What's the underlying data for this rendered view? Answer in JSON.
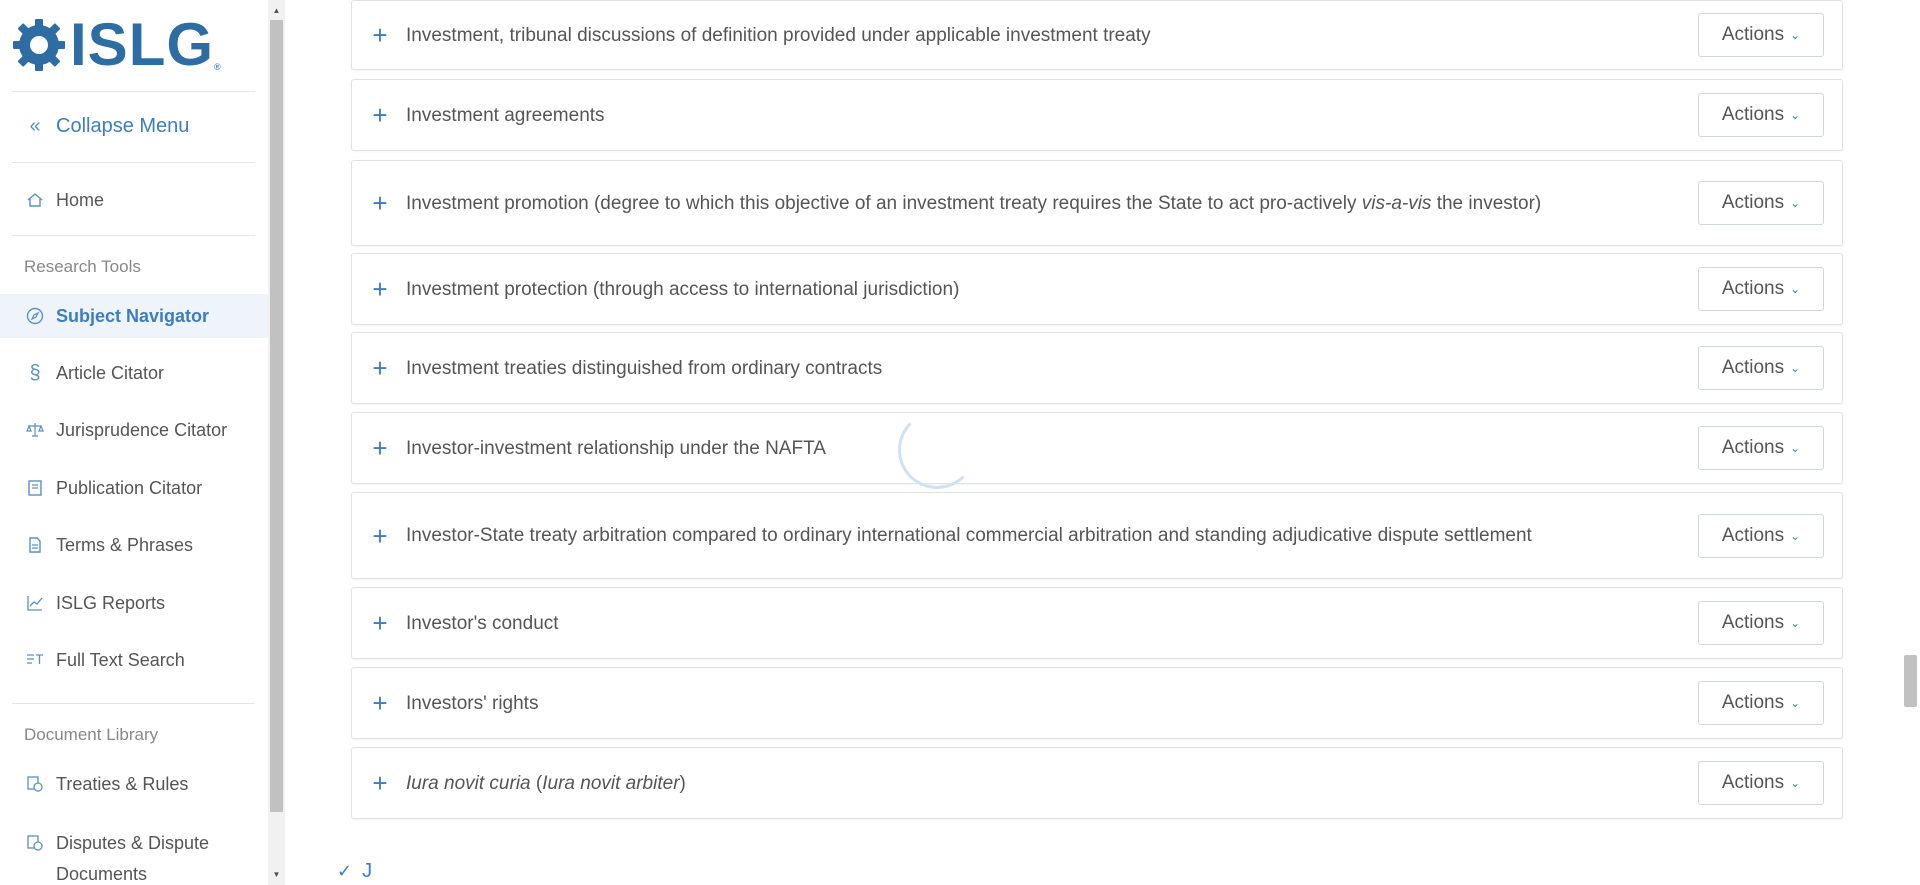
{
  "brand": {
    "name": "ISLG",
    "reg": "®"
  },
  "sidebar": {
    "collapse_label": "Collapse Menu",
    "home_label": "Home",
    "research_tools_label": "Research Tools",
    "research_items": [
      {
        "label": "Subject Navigator",
        "icon": "compass-icon"
      },
      {
        "label": "Article Citator",
        "icon": "section-icon"
      },
      {
        "label": "Jurisprudence Citator",
        "icon": "scales-icon"
      },
      {
        "label": "Publication Citator",
        "icon": "book-icon"
      },
      {
        "label": "Terms & Phrases",
        "icon": "document-icon"
      },
      {
        "label": "ISLG Reports",
        "icon": "chart-line-icon"
      },
      {
        "label": "Full Text Search",
        "icon": "text-search-icon"
      }
    ],
    "document_library_label": "Document Library",
    "library_items": [
      {
        "label": "Treaties & Rules",
        "icon": "treaty-icon"
      },
      {
        "label": "Disputes & Dispute Documents",
        "icon": "disputes-icon"
      }
    ]
  },
  "rows": [
    {
      "label": "Investment, tribunal discussions of definition provided under applicable investment treaty",
      "actions": "Actions"
    },
    {
      "label": "Investment agreements",
      "actions": "Actions"
    },
    {
      "label_pre": "Investment promotion (degree to which this objective of an investment treaty requires the State to act pro-actively ",
      "label_italic": "vis-a-vis",
      "label_post": " the investor)",
      "actions": "Actions"
    },
    {
      "label": "Investment protection (through access to international jurisdiction)",
      "actions": "Actions"
    },
    {
      "label": "Investment treaties distinguished from ordinary contracts",
      "actions": "Actions"
    },
    {
      "label": "Investor-investment relationship under the NAFTA",
      "actions": "Actions"
    },
    {
      "label": "Investor-State treaty arbitration compared to ordinary international commercial arbitration and standing adjudicative dispute settlement",
      "actions": "Actions"
    },
    {
      "label": "Investor's conduct",
      "actions": "Actions"
    },
    {
      "label": "Investors' rights",
      "actions": "Actions"
    },
    {
      "label_italic": "Iura novit curia",
      "label_mid": " (",
      "label_italic2": "Iura novit arbiter",
      "label_post": ")",
      "actions": "Actions"
    }
  ],
  "next_letter": "J",
  "colors": {
    "accent": "#3d7dc4",
    "brand": "#2e6da4",
    "active_bg": "#eef4fa"
  }
}
